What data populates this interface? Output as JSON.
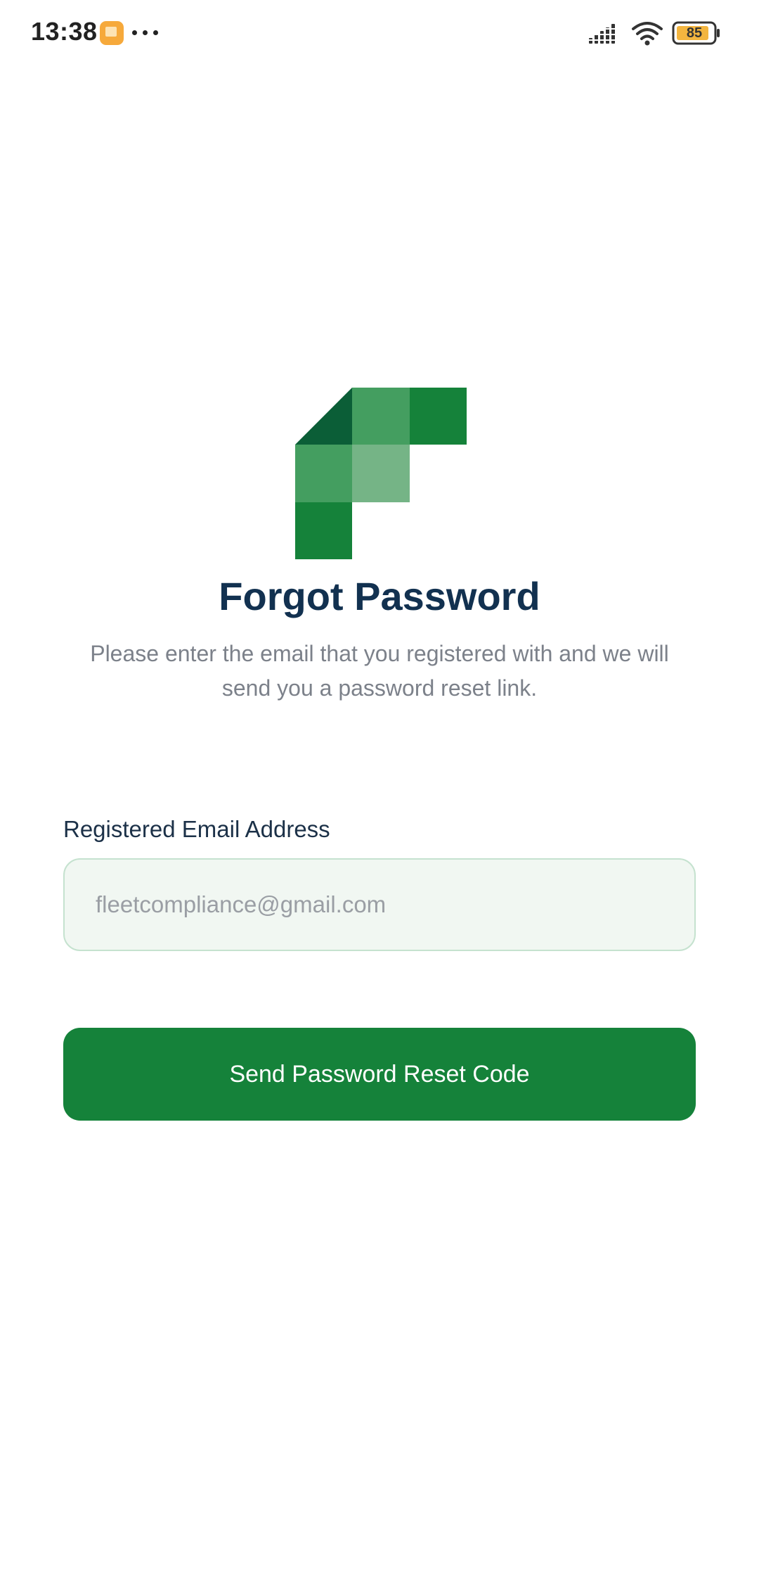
{
  "status_bar": {
    "time": "13:38",
    "battery": "85",
    "icons": [
      "notification-app-icon",
      "more-dots-icon",
      "cellular-signal-icon",
      "wifi-icon",
      "battery-icon"
    ]
  },
  "logo": {
    "icon": "brand-logo-icon",
    "colors": [
      "#0b5e37",
      "#449e60",
      "#15823a",
      "#75b486"
    ]
  },
  "header": {
    "title": "Forgot Password",
    "subtitle": "Please enter the email that you registered with and we will send you a password reset link."
  },
  "form": {
    "email_label": "Registered Email Address",
    "email_placeholder": "fleetcompliance@gmail.com",
    "email_value": "",
    "submit_label": "Send Password Reset Code"
  },
  "colors": {
    "primary": "#15823a",
    "title": "#123150",
    "subtitle": "#7c818a",
    "input_bg": "#f1f7f2",
    "input_border": "#c5e2cf"
  }
}
